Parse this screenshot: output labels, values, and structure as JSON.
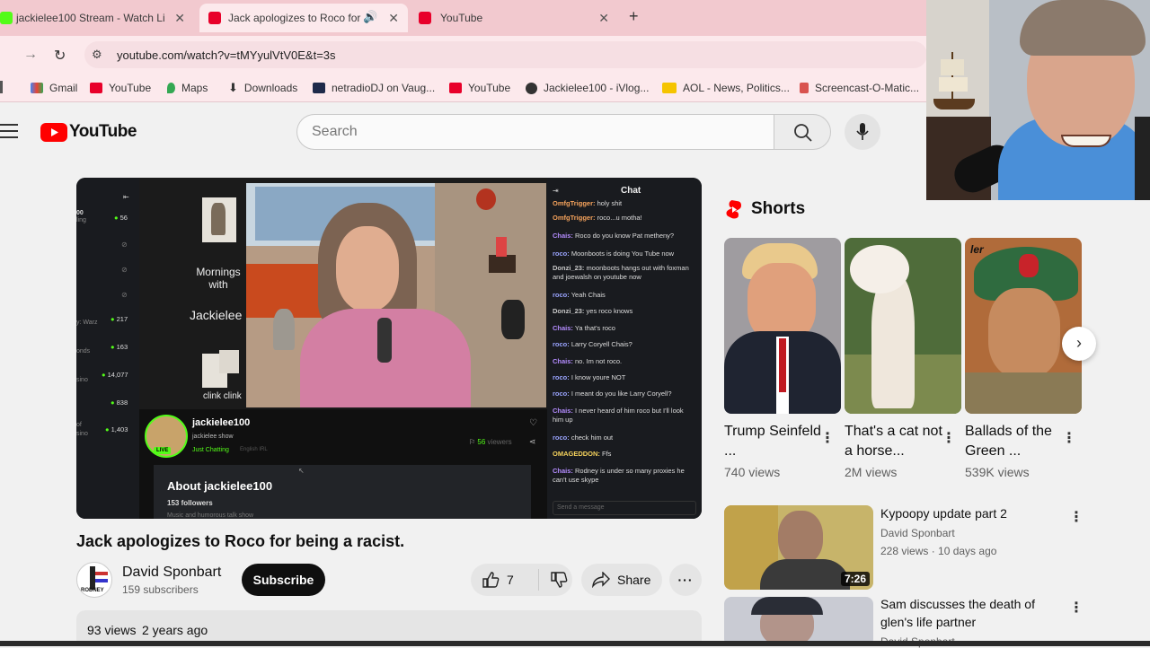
{
  "browser": {
    "tabs": [
      {
        "title": "jackielee100 Stream - Watch Li",
        "active": false
      },
      {
        "title": "Jack apologizes to Roco for",
        "active": true
      },
      {
        "title": "YouTube",
        "active": false
      }
    ],
    "new_tab": "+",
    "url": "youtube.com/watch?v=tMYyulVtV0E&t=3s",
    "bookmarks": [
      "Gmail",
      "YouTube",
      "Maps",
      "Downloads",
      "netradioDJ on Vaug...",
      "YouTube",
      "Jackielee100 - iVlog...",
      "AOL - News, Politics...",
      "Screencast-O-Matic..."
    ]
  },
  "youtube": {
    "logo_text": "YouTube",
    "search_placeholder": "Search"
  },
  "video_overlay": {
    "left_numbers": [
      "56",
      "217",
      "163",
      "14,077",
      "838",
      "1,403"
    ],
    "left_labels": [
      "00",
      "ling",
      "y: Warz",
      "onds",
      "sino",
      "sino",
      "of"
    ],
    "sign_text": [
      "Mornings",
      "with",
      "Jackielee",
      "clink clink"
    ],
    "chat_title": "Chat",
    "chat": [
      {
        "user": "OmfgTrigger:",
        "msg": "holy shit"
      },
      {
        "user": "OmfgTrigger:",
        "msg": "roco...u motha!"
      },
      {
        "user": "Chais:",
        "msg": "Roco do you know Pat metheny?"
      },
      {
        "user": "roco:",
        "msg": "Moonboots is doing You Tube now"
      },
      {
        "user": "Donzi_23:",
        "msg": "moonboots hangs out with foxman"
      },
      {
        "user": "",
        "msg": "and joewalsh on youtube now"
      },
      {
        "user": "roco:",
        "msg": "Yeah Chais"
      },
      {
        "user": "Donzi_23:",
        "msg": "yes roco knows"
      },
      {
        "user": "Chais:",
        "msg": "Ya that's roco"
      },
      {
        "user": "roco:",
        "msg": "Larry Coryell Chais?"
      },
      {
        "user": "Chais:",
        "msg": "no. Im not roco."
      },
      {
        "user": "roco:",
        "msg": "I know youre NOT"
      },
      {
        "user": "roco:",
        "msg": "I meant do you like Larry Coryell?"
      },
      {
        "user": "Chais:",
        "msg": "I never heard of him roco but I'll look"
      },
      {
        "user": "",
        "msg": "him up"
      },
      {
        "user": "roco:",
        "msg": "check him out"
      },
      {
        "user": "OMAGEDDON:",
        "msg": "Ffs"
      },
      {
        "user": "Chais:",
        "msg": "Rodney is under so many proxies he"
      },
      {
        "user": "",
        "msg": "can't use skype"
      }
    ],
    "send_placeholder": "Send a message",
    "streamer_name": "jackielee100",
    "streamer_show": "jackielee show",
    "streamer_category": "Just Chatting",
    "streamer_tags": "English  IRL",
    "live_badge": "LIVE",
    "viewer_count": "56",
    "viewers_label": "viewers",
    "about_title": "About jackielee100",
    "followers": "153 followers",
    "about_desc": "Music and humorous talk show"
  },
  "video": {
    "title": "Jack apologizes to Roco for being a racist.",
    "channel": "David Sponbart",
    "subscribers": "159 subscribers",
    "subscribe_label": "Subscribe",
    "avatar_text": "RODNEY",
    "likes": "7",
    "share_label": "Share",
    "more": "···",
    "views": "93 views",
    "age": "2 years ago"
  },
  "shorts": {
    "header": "Shorts",
    "items": [
      {
        "title": "Trump Seinfeld ...",
        "views": "740 views"
      },
      {
        "title": "That's a cat not a horse...",
        "views": "2M views"
      },
      {
        "title": "Ballads of the Green ...",
        "views": "539K views"
      }
    ],
    "thumb_text": "ler"
  },
  "related": [
    {
      "title": "Kypoopy update part 2",
      "channel": "David Sponbart",
      "meta": "228 views · 10 days ago",
      "duration": "7:26"
    },
    {
      "title": "Sam discusses the death of glen's life partner",
      "channel": "David Sponbart",
      "meta": "",
      "duration": ""
    }
  ],
  "colors": {
    "tabbar": "#f2c9cf",
    "toolbar": "#fce9ec",
    "yt_red": "#ff0000",
    "subscribe_bg": "#0f0f0f",
    "live_green": "#53fc18"
  }
}
